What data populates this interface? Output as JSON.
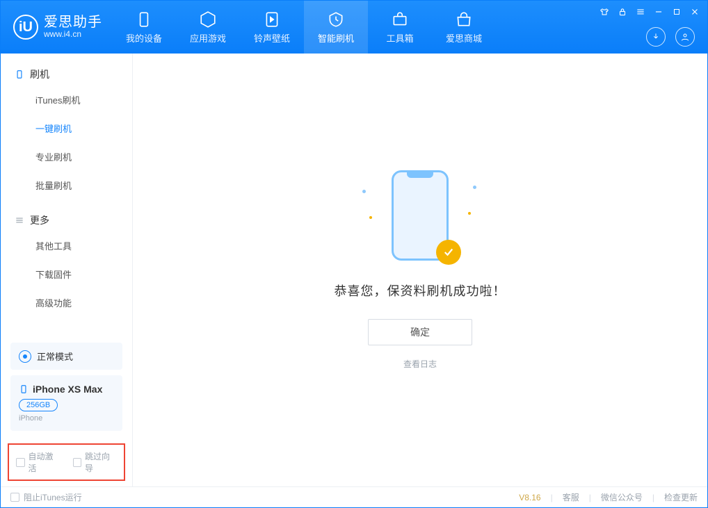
{
  "app": {
    "name": "爱思助手",
    "url": "www.i4.cn"
  },
  "tabs": {
    "device": "我的设备",
    "apps": "应用游戏",
    "ring": "铃声壁纸",
    "flash": "智能刷机",
    "toolbox": "工具箱",
    "store": "爱思商城"
  },
  "sidebar": {
    "flash_header": "刷机",
    "itunes_flash": "iTunes刷机",
    "oneclick_flash": "一键刷机",
    "pro_flash": "专业刷机",
    "batch_flash": "批量刷机",
    "more_header": "更多",
    "other_tools": "其他工具",
    "download_fw": "下载固件",
    "advanced": "高级功能"
  },
  "device": {
    "mode": "正常模式",
    "name": "iPhone XS Max",
    "capacity": "256GB",
    "type": "iPhone"
  },
  "checks": {
    "auto_activate": "自动激活",
    "skip_guide": "跳过向导"
  },
  "main": {
    "message": "恭喜您，保资料刷机成功啦！",
    "ok": "确定",
    "view_log": "查看日志"
  },
  "footer": {
    "block_itunes": "阻止iTunes运行",
    "version": "V8.16",
    "support": "客服",
    "wechat": "微信公众号",
    "update": "检查更新"
  }
}
